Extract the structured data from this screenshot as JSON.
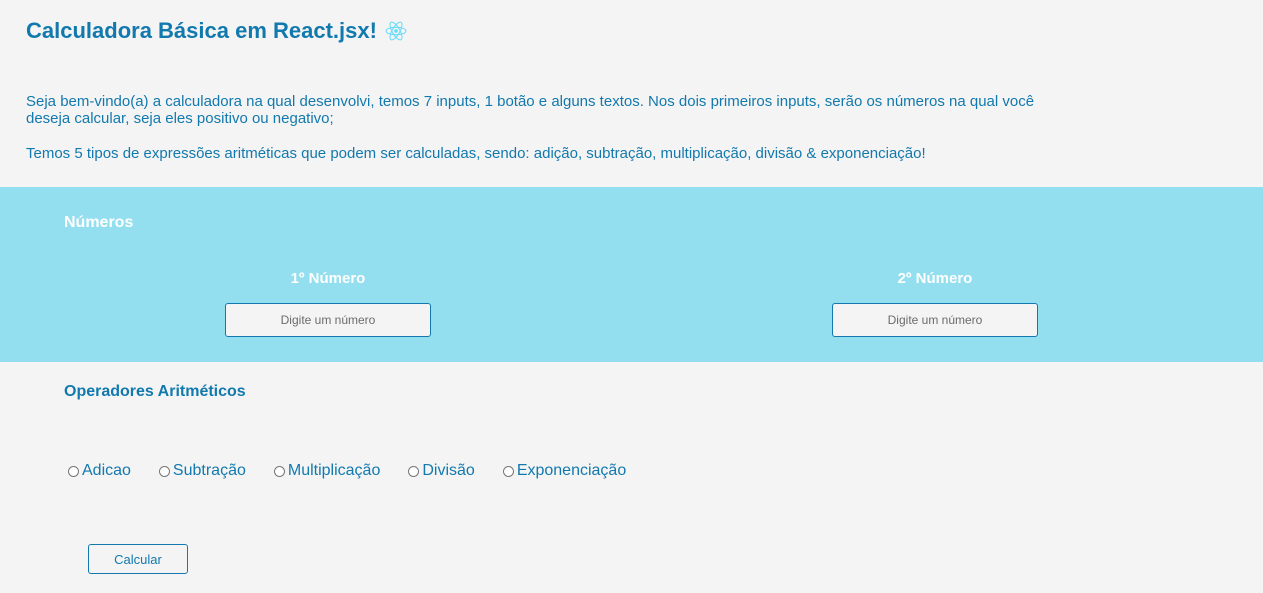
{
  "header": {
    "title": "Calculadora Básica em React.jsx!",
    "icon": "react-icon"
  },
  "intro": {
    "paragraph1": "Seja bem-vindo(a) a calculadora na qual desenvolvi, temos 7 inputs, 1 botão e alguns textos. Nos dois primeiros inputs, serão os números na qual você deseja calcular, seja eles positivo ou negativo;",
    "paragraph2": "Temos 5 tipos de expressões aritméticas que podem ser calculadas, sendo: adição, subtração, multiplicação, divisão & exponenciação!"
  },
  "numbers": {
    "heading": "Números",
    "first": {
      "label": "1º Número",
      "placeholder": "Digite um número",
      "value": ""
    },
    "second": {
      "label": "2º Número",
      "placeholder": "Digite um número",
      "value": ""
    }
  },
  "operators": {
    "heading": "Operadores Aritméticos",
    "options": [
      {
        "label": "Adicao",
        "checked": false
      },
      {
        "label": "Subtração",
        "checked": false
      },
      {
        "label": "Multiplicação",
        "checked": false
      },
      {
        "label": "Divisão",
        "checked": false
      },
      {
        "label": "Exponenciação",
        "checked": false
      }
    ]
  },
  "actions": {
    "calculate_label": "Calcular"
  },
  "colors": {
    "primary": "#1279ae",
    "band": "#93dfef",
    "background": "#f4f4f4",
    "react_icon": "#61dafb"
  }
}
